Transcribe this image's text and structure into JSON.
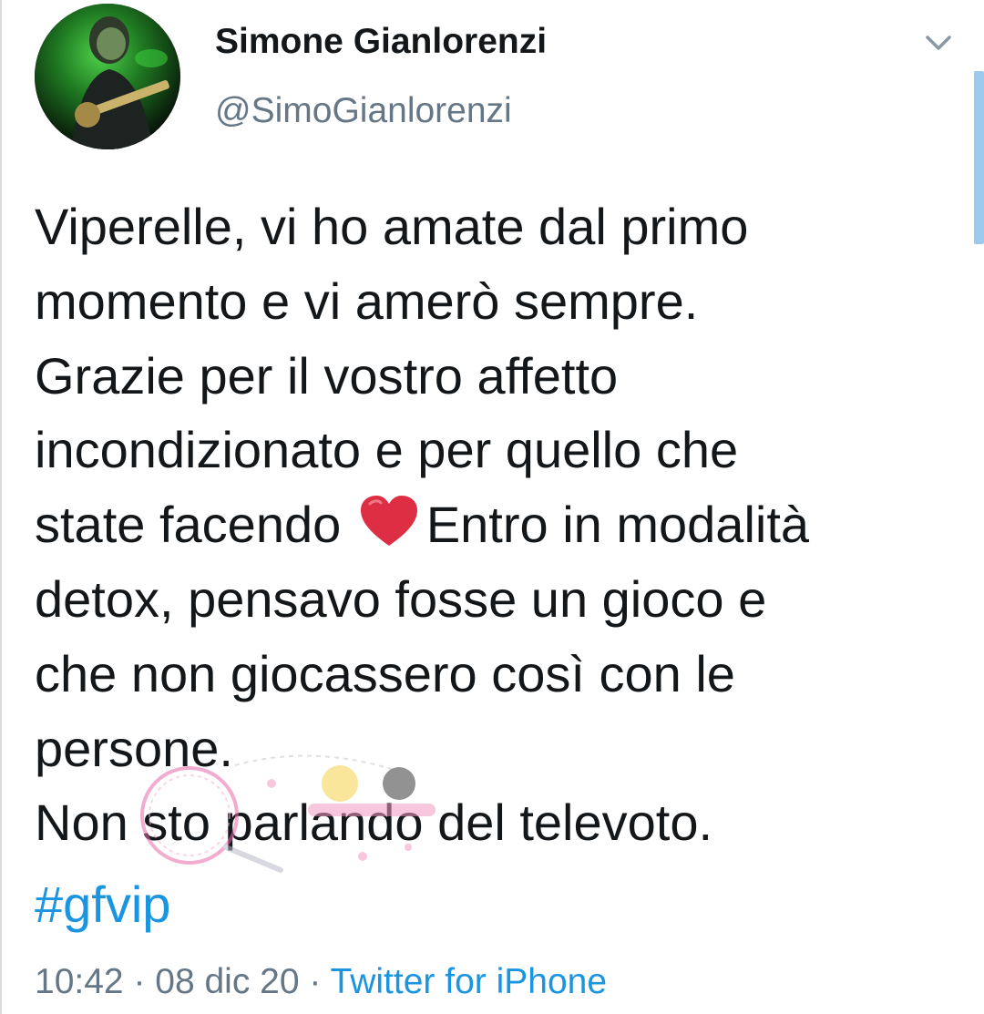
{
  "tweet": {
    "author": {
      "display_name": "Simone Gianlorenzi",
      "handle": "@SimoGianlorenzi"
    },
    "text_part1": "Viperelle, vi ho amate dal primo\nmomento e vi amerò sempre.\nGrazie per il vostro affetto\nincondizionato e per quello che\nstate facendo ",
    "emoji": "red-heart-icon",
    "text_part2": "Entro in modalità\ndetox, pensavo fosse un gioco e\nche non giocassero così con le\npersone.\nNon sto parlando del televoto.",
    "hashtag": "#gfvip",
    "time": "10:42",
    "separator": " · ",
    "date": "08 dic 20",
    "source": "Twitter for iPhone"
  },
  "icons": {
    "menu": "chevron-down-icon",
    "avatar": "avatar-photo"
  },
  "colors": {
    "text": "#14171a",
    "secondary": "#657786",
    "link": "#1b95e0",
    "heart": "#dd2e44",
    "scrollbar": "#9cc9ee"
  }
}
